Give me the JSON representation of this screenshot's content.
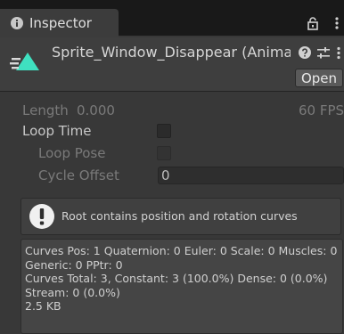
{
  "tab": {
    "title": "Inspector",
    "icon": "info-icon"
  },
  "window_icons": [
    "lock-icon",
    "kebab-menu-icon"
  ],
  "header": {
    "title": "Sprite_Window_Disappear (Animati",
    "icon": "animation-clip-icon",
    "icons": [
      "help-icon",
      "preset-icon",
      "kebab-menu-icon"
    ],
    "open_label": "Open"
  },
  "clip": {
    "length_label": "Length",
    "length_value": "0.000",
    "fps": "60 FPS",
    "loop_time_label": "Loop Time",
    "loop_time_checked": false,
    "loop_pose_label": "Loop Pose",
    "loop_pose_checked": false,
    "cycle_offset_label": "Cycle Offset",
    "cycle_offset_value": "0"
  },
  "helpbox": {
    "icon": "warning-icon",
    "message": "Root contains position and rotation curves"
  },
  "info": {
    "lines": [
      "Curves Pos: 1 Quaternion: 0 Euler: 0 Scale: 0 Muscles: 0",
      "Generic: 0 PPtr: 0",
      "Curves Total: 3, Constant: 3 (100.0%) Dense: 0 (0.0%)",
      "Stream: 0 (0.0%)",
      "2.5 KB"
    ]
  },
  "colors": {
    "background": "#383838",
    "tab_bar": "#191919",
    "accent_icon": "#3fe0c0"
  }
}
